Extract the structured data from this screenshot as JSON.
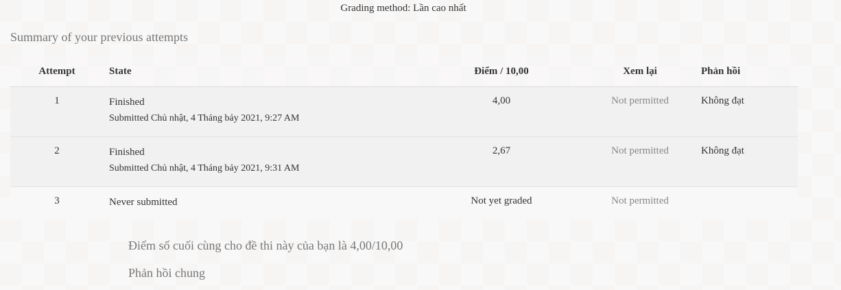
{
  "grading_method": "Grading method: Lần cao nhất",
  "summary_title": "Summary of your previous attempts",
  "table": {
    "headers": {
      "attempt": "Attempt",
      "state": "State",
      "grade": "Điểm / 10,00",
      "review": "Xem lại",
      "feedback": "Phản hồi"
    },
    "rows": [
      {
        "attempt": "1",
        "state": "Finished",
        "submitted": "Submitted Chủ nhật, 4 Tháng bảy 2021, 9:27 AM",
        "grade": "4,00",
        "review": "Not permitted",
        "feedback": "Không đạt"
      },
      {
        "attempt": "2",
        "state": "Finished",
        "submitted": "Submitted Chủ nhật, 4 Tháng bảy 2021, 9:31 AM",
        "grade": "2,67",
        "review": "Not permitted",
        "feedback": "Không đạt"
      },
      {
        "attempt": "3",
        "state": "Never submitted",
        "grade": "Not yet graded",
        "review": "Not permitted"
      }
    ]
  },
  "final_grade": "Điểm số cuối cùng cho đề thi này của bạn là 4,00/10,00",
  "overall_feedback_heading": "Phản hồi chung"
}
